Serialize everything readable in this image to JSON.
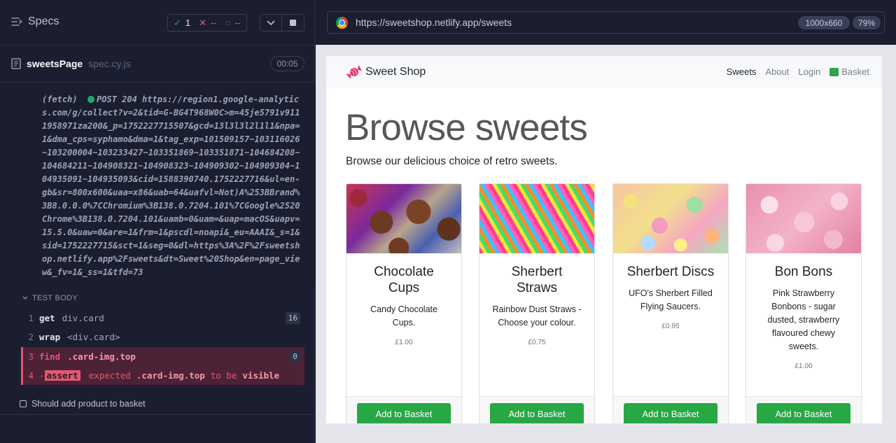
{
  "reporter": {
    "specs_label": "Specs",
    "stats": {
      "passed": "1",
      "failed": "--",
      "pending": "--"
    },
    "spec_file_name": "sweetsPage",
    "spec_file_ext": "spec.cy.js",
    "duration": "00:05",
    "fetch_log": {
      "prefix": "(fetch)",
      "text": "POST 204 https://region1.google-analytics.com/g/collect?v=2&tid=G-BG4T968W0C>m=45je5791v9111958971za200&_p=1752227715507&gcd=13l3l3l2l1l1&npa=1&dma_cps=syphamo&dma=1&tag_exp=101509157~103116026~103200004~103233427~103351869~103351871~104684208~104684211~104908321~104908323~104909302~104909304~104935091~104935093&cid=1588390740.1752227716&ul=en-gb&sr=800x600&uaa=x86&uab=64&uafvl=Not)A%253BBrand%3B8.0.0.0%7CChromium%3B138.0.7204.101%7CGoogle%2520Chrome%3B138.0.7204.101&uamb=0&uam=&uap=macOS&uapv=15.5.0&uaw=0&are=1&frm=1&pscdl=noapi&_eu=AAAI&_s=1&sid=1752227715&sct=1&seg=0&dl=https%3A%2F%2Fsweetshop.netlify.app%2Fsweets&dt=Sweet%20Shop&en=page_view&_fv=1&_ss=1&tfd=73"
    },
    "test_body_label": "TEST BODY",
    "commands": [
      {
        "num": "1",
        "name": "get",
        "arg": "div.card",
        "badge": "16"
      },
      {
        "num": "2",
        "name": "wrap",
        "arg": "<div.card>",
        "badge": ""
      },
      {
        "num": "3",
        "name": "find",
        "arg": ".card-img.top",
        "badge": "0"
      },
      {
        "num": "4",
        "dash": "-",
        "name": "assert",
        "expected": "expected",
        "selector": ".card-img.top",
        "to_be": "to be",
        "visible": "visible"
      }
    ],
    "test_item": "Should add product to basket"
  },
  "browser": {
    "url": "https://sweetshop.netlify.app/sweets",
    "viewport_size": "1000x660",
    "zoom": "79%"
  },
  "site": {
    "brand": "Sweet Shop",
    "nav": {
      "sweets": "Sweets",
      "about": "About",
      "login": "Login",
      "basket_count": "0",
      "basket": "Basket"
    },
    "hero_title": "Browse sweets",
    "hero_lead": "Browse our delicious choice of retro sweets.",
    "products": [
      {
        "title": "Chocolate Cups",
        "description": "Candy Chocolate Cups.",
        "price": "£1.00",
        "button": "Add to Basket"
      },
      {
        "title": "Sherbert Straws",
        "description": "Rainbow Dust Straws - Choose your colour.",
        "price": "£0.75",
        "button": "Add to Basket"
      },
      {
        "title": "Sherbert Discs",
        "description": "UFO's Sherbert Filled Flying Saucers.",
        "price": "£0.95",
        "button": "Add to Basket"
      },
      {
        "title": "Bon Bons",
        "description": "Pink Strawberry Bonbons - sugar dusted, strawberry flavoured chewy sweets.",
        "price": "£1.00",
        "button": "Add to Basket"
      }
    ]
  },
  "colors": {
    "pass": "#1fa971",
    "fail": "#e45770",
    "button_green": "#28a745"
  },
  "icons": [
    "specs-icon",
    "check-icon",
    "x-icon",
    "spinner-icon",
    "chevron-down-icon",
    "stop-icon",
    "file-icon",
    "chrome-icon",
    "candy-icon",
    "checkbox-icon"
  ]
}
